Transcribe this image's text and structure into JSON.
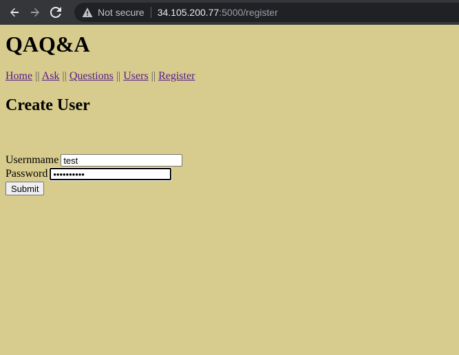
{
  "browser": {
    "security_label": "Not secure",
    "url_host": "34.105.200.77",
    "url_path": ":5000/register"
  },
  "site": {
    "title": "QAQ&A",
    "nav": [
      {
        "label": "Home"
      },
      {
        "label": "Ask"
      },
      {
        "label": "Questions"
      },
      {
        "label": "Users"
      },
      {
        "label": "Register"
      }
    ],
    "separator": "||"
  },
  "form": {
    "heading": "Create User",
    "username_label": "Usernmame",
    "username_value": "test",
    "password_label": "Password",
    "password_value": "••••••••••",
    "submit_label": "Submit"
  }
}
